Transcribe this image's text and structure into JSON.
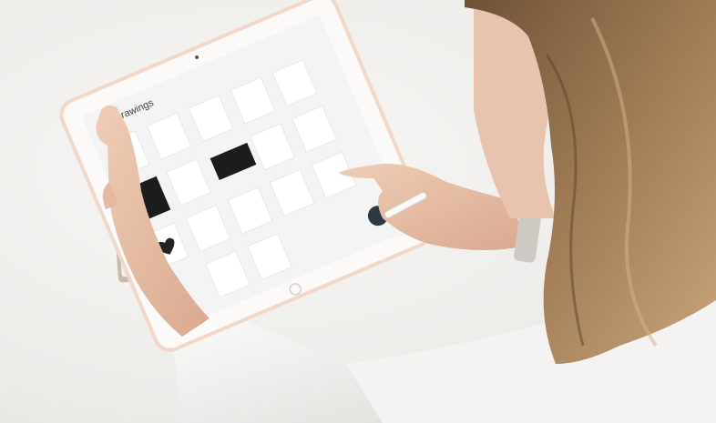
{
  "screen": {
    "back_label": "My drawings",
    "back_icon": "chevron-left-icon"
  },
  "colors": {
    "tablet_frame": "#f2d8c9",
    "screen_bg": "#f4f4f4",
    "sleeve": "#f5f5f3",
    "hair": "#8a6a48",
    "skin": "#e9c3ab"
  }
}
